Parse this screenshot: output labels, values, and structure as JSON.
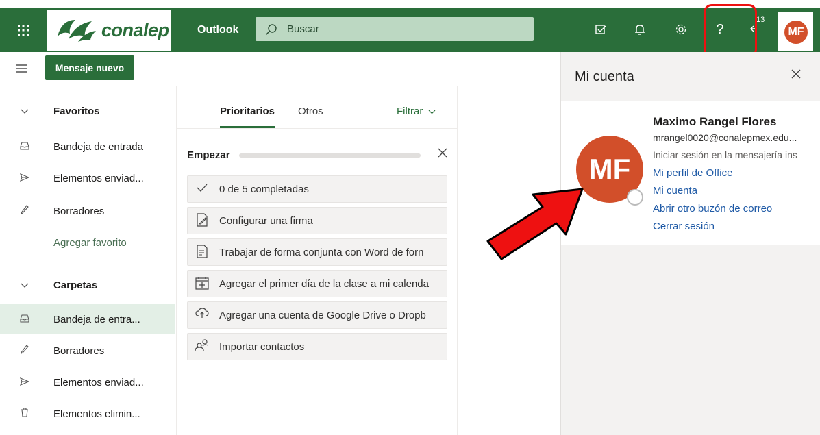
{
  "header": {
    "logo_text": "conalep",
    "app_name": "Outlook",
    "search_placeholder": "Buscar",
    "notification_count": "13",
    "avatar_initials": "MF",
    "icons": [
      "waffle-icon",
      "search-icon",
      "my-day-icon",
      "bell-icon",
      "gear-icon",
      "help-icon",
      "feedback-icon"
    ]
  },
  "toolbar": {
    "new_message_label": "Mensaje nuevo"
  },
  "sidebar": {
    "favorites_header": "Favoritos",
    "favorites": [
      {
        "label": "Bandeja de entrada",
        "icon": "inbox-icon"
      },
      {
        "label": "Elementos enviad...",
        "icon": "send-icon"
      },
      {
        "label": "Borradores",
        "icon": "pencil-icon"
      }
    ],
    "add_favorite": "Agregar favorito",
    "folders_header": "Carpetas",
    "folders": [
      {
        "label": "Bandeja de entra...",
        "icon": "inbox-icon",
        "selected": true
      },
      {
        "label": "Borradores",
        "icon": "pencil-icon"
      },
      {
        "label": "Elementos enviad...",
        "icon": "send-icon"
      },
      {
        "label": "Elementos elimin...",
        "icon": "trash-icon"
      }
    ]
  },
  "mail_list": {
    "tabs": [
      {
        "label": "Prioritarios",
        "active": true
      },
      {
        "label": "Otros",
        "active": false
      }
    ],
    "filter_label": "Filtrar",
    "getting_started": {
      "title": "Empezar",
      "tasks": [
        {
          "label": "0 de 5 completadas",
          "icon": "check-icon"
        },
        {
          "label": "Configurar una firma",
          "icon": "signature-icon"
        },
        {
          "label": "Trabajar de forma conjunta con Word de forn",
          "icon": "word-doc-icon"
        },
        {
          "label": "Agregar el primer día de la clase a mi calenda",
          "icon": "calendar-add-icon"
        },
        {
          "label": "Agregar una cuenta de Google Drive o Dropb",
          "icon": "cloud-icon"
        },
        {
          "label": "Importar contactos",
          "icon": "contacts-icon"
        }
      ]
    }
  },
  "account_panel": {
    "title": "Mi cuenta",
    "initials": "MF",
    "name": "Maximo Rangel Flores",
    "email": "mrangel0020@conalepmex.edu...",
    "signin_text": "Iniciar sesión en la mensajería ins",
    "links": [
      "Mi perfil de Office",
      "Mi cuenta",
      "Abrir otro buzón de correo",
      "Cerrar sesión"
    ]
  },
  "colors": {
    "brand_green": "#2a6e3a",
    "avatar_orange": "#d24f2a",
    "link_blue": "#1f5aa6",
    "highlight_red": "#e11111"
  }
}
